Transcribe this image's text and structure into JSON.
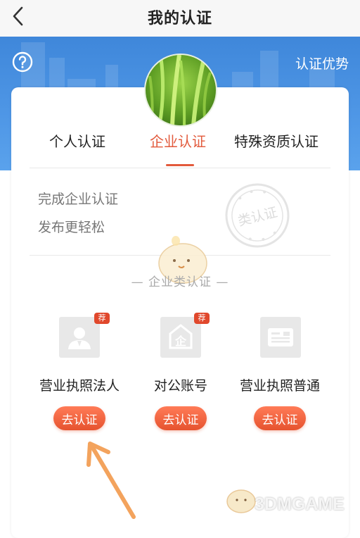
{
  "header": {
    "title": "我的认证",
    "back_icon": "chevron-left-icon"
  },
  "banner": {
    "help_icon": "question-circle-icon",
    "advantage_label": "认证优势",
    "background_color": "#4a90e2"
  },
  "tabs": [
    {
      "label": "个人认证",
      "active": false
    },
    {
      "label": "企业认证",
      "active": true
    },
    {
      "label": "特殊资质认证",
      "active": false
    }
  ],
  "promo": {
    "line1": "完成企业认证",
    "line2": "发布更轻松",
    "stamp_text": "类认证"
  },
  "section_title": "— 企业类认证 —",
  "options": [
    {
      "label": "营业执照法人",
      "icon": "person-id-icon",
      "badge": "荐",
      "button": "去认证"
    },
    {
      "label": "对公账号",
      "icon": "enterprise-icon",
      "badge": "荐",
      "button": "去认证"
    },
    {
      "label": "营业执照普通",
      "icon": "id-card-icon",
      "badge": "",
      "button": "去认证"
    }
  ],
  "watermark": {
    "text": "3DMGAME"
  },
  "colors": {
    "accent": "#e25a3c",
    "button": "#e6532f",
    "banner": "#4a90e2",
    "arrow": "#f3a35d"
  }
}
